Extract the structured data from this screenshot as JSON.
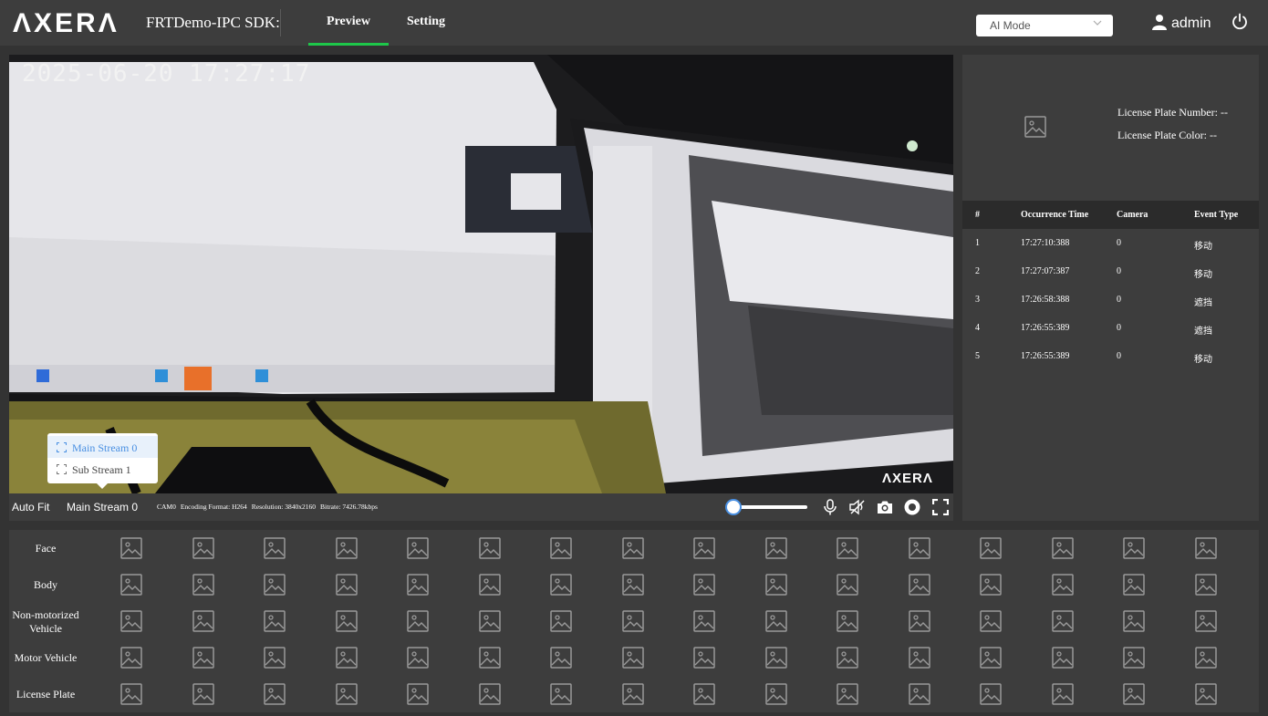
{
  "header": {
    "brand": "AXERA",
    "sdk_title": "FRTDemo-IPC SDK:",
    "tabs": [
      {
        "label": "Preview",
        "active": true
      },
      {
        "label": "Setting",
        "active": false
      }
    ],
    "mode_select": {
      "value": "AI Mode"
    },
    "user": "admin",
    "accent_color": "#1ec74a"
  },
  "video": {
    "osd_timestamp": "2025-06-20  17:27:17",
    "watermark": "AXERA",
    "stream_menu": {
      "options": [
        "Main Stream 0",
        "Sub Stream 1"
      ],
      "selected": "Main Stream 0"
    },
    "controls": {
      "auto_fit": "Auto Fit",
      "stream": "Main Stream 0",
      "camera": "CAM0",
      "encoding": "Encoding Format: H264",
      "resolution": "Resolution: 3840x2160",
      "bitrate": "Bitrate: 7426.78kbps",
      "volume": 0
    }
  },
  "plate_panel": {
    "number_label": "License Plate Number: --",
    "color_label": "License Plate Color: --"
  },
  "events": {
    "columns": [
      "#",
      "Occurrence Time",
      "Camera",
      "Event Type"
    ],
    "rows": [
      {
        "idx": "1",
        "time": "17:27:10:388",
        "camera": "0",
        "type": "移动"
      },
      {
        "idx": "2",
        "time": "17:27:07:387",
        "camera": "0",
        "type": "移动"
      },
      {
        "idx": "3",
        "time": "17:26:58:388",
        "camera": "0",
        "type": "遮挡"
      },
      {
        "idx": "4",
        "time": "17:26:55:389",
        "camera": "0",
        "type": "遮挡"
      },
      {
        "idx": "5",
        "time": "17:26:55:389",
        "camera": "0",
        "type": "移动"
      }
    ]
  },
  "captures": {
    "categories": [
      "Face",
      "Body",
      "Non-motorized Vehicle",
      "Motor Vehicle",
      "License Plate"
    ],
    "thumbs_per_row": 16,
    "thumb_icon": "image-placeholder-icon"
  }
}
